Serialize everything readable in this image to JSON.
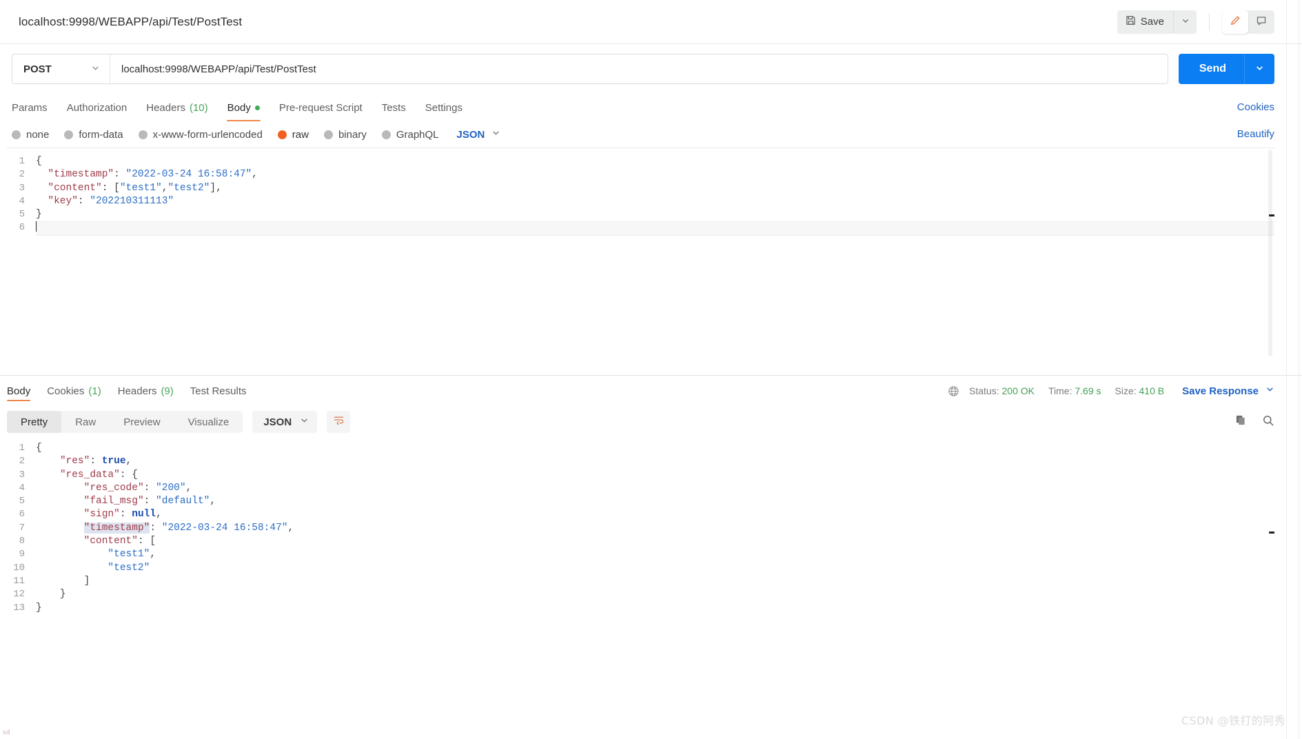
{
  "window": {
    "request_title": "localhost:9998/WEBAPP/api/Test/PostTest"
  },
  "toolbar": {
    "save_label": "Save",
    "save_caret_icon": "chevron-down-icon",
    "save_icon": "floppy-disk-icon",
    "edit_icon": "pencil-icon",
    "comment_icon": "comment-icon"
  },
  "request": {
    "method": "POST",
    "method_caret_icon": "chevron-down-icon",
    "url": "localhost:9998/WEBAPP/api/Test/PostTest",
    "url_placeholder": "Enter request URL",
    "send_label": "Send",
    "send_caret_icon": "chevron-down-icon",
    "tabs": [
      {
        "label": "Params",
        "count": "",
        "active": false,
        "dot": false
      },
      {
        "label": "Authorization",
        "count": "",
        "active": false,
        "dot": false
      },
      {
        "label": "Headers",
        "count": "(10)",
        "active": false,
        "dot": false
      },
      {
        "label": "Body",
        "count": "",
        "active": true,
        "dot": true
      },
      {
        "label": "Pre-request Script",
        "count": "",
        "active": false,
        "dot": false
      },
      {
        "label": "Tests",
        "count": "",
        "active": false,
        "dot": false
      },
      {
        "label": "Settings",
        "count": "",
        "active": false,
        "dot": false
      }
    ],
    "cookies_link": "Cookies",
    "beautify_link": "Beautify",
    "body_types": [
      {
        "label": "none",
        "selected": false
      },
      {
        "label": "form-data",
        "selected": false
      },
      {
        "label": "x-www-form-urlencoded",
        "selected": false
      },
      {
        "label": "raw",
        "selected": true
      },
      {
        "label": "binary",
        "selected": false
      },
      {
        "label": "GraphQL",
        "selected": false
      }
    ],
    "raw_format": "JSON",
    "raw_format_caret_icon": "chevron-down-icon",
    "body_lines": [
      {
        "n": "1",
        "tokens": [
          {
            "t": "{",
            "c": "p"
          }
        ]
      },
      {
        "n": "2",
        "tokens": [
          {
            "t": "  ",
            "c": "p"
          },
          {
            "t": "\"timestamp\"",
            "c": "k"
          },
          {
            "t": ": ",
            "c": "p"
          },
          {
            "t": "\"2022-03-24 16:58:47\"",
            "c": "s"
          },
          {
            "t": ",",
            "c": "p"
          }
        ]
      },
      {
        "n": "3",
        "tokens": [
          {
            "t": "  ",
            "c": "p"
          },
          {
            "t": "\"content\"",
            "c": "k"
          },
          {
            "t": ": [",
            "c": "p"
          },
          {
            "t": "\"test1\"",
            "c": "s"
          },
          {
            "t": ",",
            "c": "p"
          },
          {
            "t": "\"test2\"",
            "c": "s"
          },
          {
            "t": "],",
            "c": "p"
          }
        ]
      },
      {
        "n": "4",
        "tokens": [
          {
            "t": "  ",
            "c": "p"
          },
          {
            "t": "\"key\"",
            "c": "k"
          },
          {
            "t": ": ",
            "c": "p"
          },
          {
            "t": "\"202210311113\"",
            "c": "s"
          }
        ]
      },
      {
        "n": "5",
        "tokens": [
          {
            "t": "}",
            "c": "p"
          }
        ]
      },
      {
        "n": "6",
        "cursor": true,
        "tokens": []
      }
    ]
  },
  "response": {
    "tabs": [
      {
        "label": "Body",
        "count": "",
        "active": true
      },
      {
        "label": "Cookies",
        "count": "(1)",
        "active": false
      },
      {
        "label": "Headers",
        "count": "(9)",
        "active": false
      },
      {
        "label": "Test Results",
        "count": "",
        "active": false
      }
    ],
    "globe_icon": "globe-icon",
    "status_label": "Status:",
    "status_value": "200 OK",
    "time_label": "Time:",
    "time_value": "7.69 s",
    "size_label": "Size:",
    "size_value": "410 B",
    "save_response_label": "Save Response",
    "save_response_caret_icon": "chevron-down-icon",
    "view_modes": [
      {
        "label": "Pretty",
        "active": true
      },
      {
        "label": "Raw",
        "active": false
      },
      {
        "label": "Preview",
        "active": false
      },
      {
        "label": "Visualize",
        "active": false
      }
    ],
    "format": "JSON",
    "format_caret_icon": "chevron-down-icon",
    "wrap_icon": "word-wrap-icon",
    "copy_icon": "copy-icon",
    "search_icon": "search-icon",
    "body_lines": [
      {
        "n": "1",
        "tokens": [
          {
            "t": "{",
            "c": "p"
          }
        ]
      },
      {
        "n": "2",
        "tokens": [
          {
            "t": "    ",
            "c": "p"
          },
          {
            "t": "\"res\"",
            "c": "k"
          },
          {
            "t": ": ",
            "c": "p"
          },
          {
            "t": "true",
            "c": "b"
          },
          {
            "t": ",",
            "c": "p"
          }
        ]
      },
      {
        "n": "3",
        "tokens": [
          {
            "t": "    ",
            "c": "p"
          },
          {
            "t": "\"res_data\"",
            "c": "k"
          },
          {
            "t": ": {",
            "c": "p"
          }
        ]
      },
      {
        "n": "4",
        "tokens": [
          {
            "t": "        ",
            "c": "p"
          },
          {
            "t": "\"res_code\"",
            "c": "k"
          },
          {
            "t": ": ",
            "c": "p"
          },
          {
            "t": "\"200\"",
            "c": "s"
          },
          {
            "t": ",",
            "c": "p"
          }
        ]
      },
      {
        "n": "5",
        "tokens": [
          {
            "t": "        ",
            "c": "p"
          },
          {
            "t": "\"fail_msg\"",
            "c": "k"
          },
          {
            "t": ": ",
            "c": "p"
          },
          {
            "t": "\"default\"",
            "c": "s"
          },
          {
            "t": ",",
            "c": "p"
          }
        ]
      },
      {
        "n": "6",
        "tokens": [
          {
            "t": "        ",
            "c": "p"
          },
          {
            "t": "\"sign\"",
            "c": "k"
          },
          {
            "t": ": ",
            "c": "p"
          },
          {
            "t": "null",
            "c": "b"
          },
          {
            "t": ",",
            "c": "p"
          }
        ]
      },
      {
        "n": "7",
        "tokens": [
          {
            "t": "        ",
            "c": "p"
          },
          {
            "t": "\"timestamp\"",
            "c": "k",
            "hl": true
          },
          {
            "t": ": ",
            "c": "p"
          },
          {
            "t": "\"2022-03-24 16:58:47\"",
            "c": "s"
          },
          {
            "t": ",",
            "c": "p"
          }
        ]
      },
      {
        "n": "8",
        "tokens": [
          {
            "t": "        ",
            "c": "p"
          },
          {
            "t": "\"content\"",
            "c": "k"
          },
          {
            "t": ": [",
            "c": "p"
          }
        ]
      },
      {
        "n": "9",
        "tokens": [
          {
            "t": "            ",
            "c": "p"
          },
          {
            "t": "\"test1\"",
            "c": "s"
          },
          {
            "t": ",",
            "c": "p"
          }
        ]
      },
      {
        "n": "10",
        "tokens": [
          {
            "t": "            ",
            "c": "p"
          },
          {
            "t": "\"test2\"",
            "c": "s"
          }
        ]
      },
      {
        "n": "11",
        "tokens": [
          {
            "t": "        ]",
            "c": "p"
          }
        ]
      },
      {
        "n": "12",
        "tokens": [
          {
            "t": "    }",
            "c": "p"
          }
        ]
      },
      {
        "n": "13",
        "tokens": [
          {
            "t": "}",
            "c": "p"
          }
        ]
      }
    ]
  },
  "watermark": "CSDN @铁打的阿秀",
  "corner_mark": "sd"
}
